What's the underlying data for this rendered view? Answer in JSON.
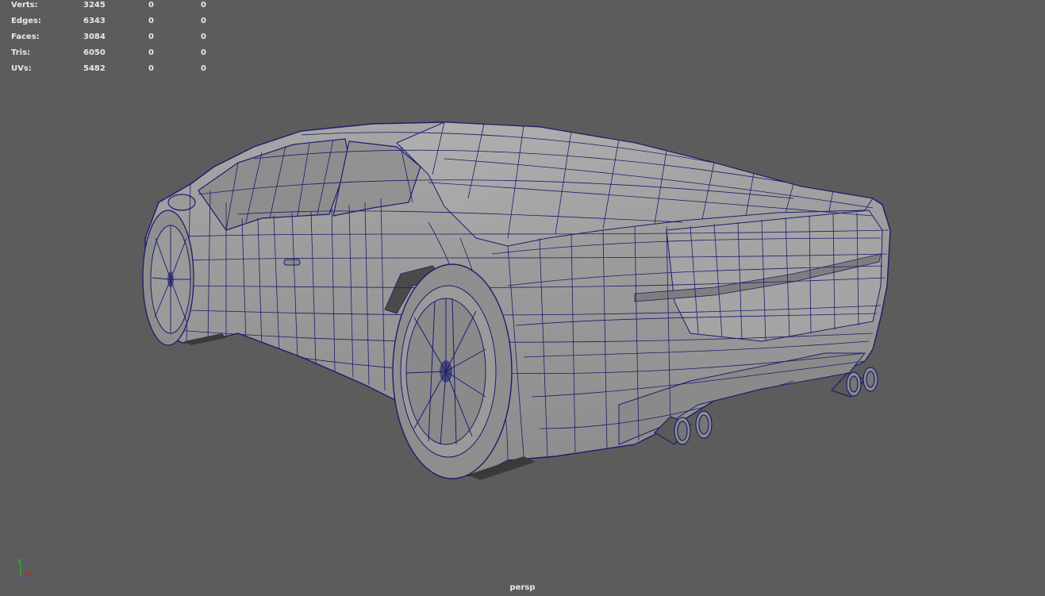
{
  "hud": {
    "rows": [
      {
        "label": "Verts:",
        "values": [
          "3245",
          "0",
          "0"
        ]
      },
      {
        "label": "Edges:",
        "values": [
          "6343",
          "0",
          "0"
        ]
      },
      {
        "label": "Faces:",
        "values": [
          "3084",
          "0",
          "0"
        ]
      },
      {
        "label": "Tris:",
        "values": [
          "6050",
          "0",
          "0"
        ]
      },
      {
        "label": "UVs:",
        "values": [
          "5482",
          "0",
          "0"
        ]
      }
    ]
  },
  "viewport": {
    "camera_label": "persp",
    "background": "#5c5c5c",
    "wire_color": "#1c1c6e",
    "surface_color": "#9c9c9c"
  },
  "axis_gizmo": {
    "y_label": "y",
    "x_color": "#cc2222",
    "y_color": "#33aa33",
    "z_color": "#3355cc"
  }
}
